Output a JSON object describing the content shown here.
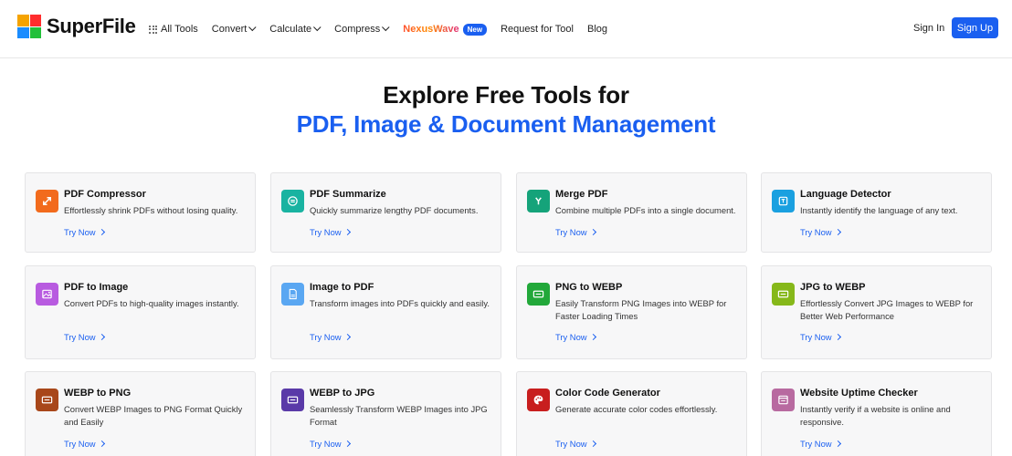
{
  "header": {
    "logo_text": "SuperFile",
    "nav": {
      "all_tools": "All Tools",
      "convert": "Convert",
      "calculate": "Calculate",
      "compress": "Compress",
      "nexuswave": "NexusWave",
      "new_badge": "New",
      "request": "Request for Tool",
      "blog": "Blog"
    },
    "sign_in": "Sign In",
    "sign_up": "Sign Up"
  },
  "hero": {
    "title": "Explore Free Tools for",
    "subtitle": "PDF, Image & Document Management"
  },
  "cards": [
    {
      "title": "PDF Compressor",
      "desc": "Effortlessly shrink PDFs without losing quality.",
      "cta": "Try Now",
      "icon": "compress-icon",
      "color": "#f26b1d"
    },
    {
      "title": "PDF Summarize",
      "desc": "Quickly summarize lengthy PDF documents.",
      "cta": "Try Now",
      "icon": "summarize-icon",
      "color": "#19b3a1"
    },
    {
      "title": "Merge PDF",
      "desc": "Combine multiple PDFs into a single document.",
      "cta": "Try Now",
      "icon": "merge-icon",
      "color": "#15a37a"
    },
    {
      "title": "Language Detector",
      "desc": "Instantly identify the language of any text.",
      "cta": "Try Now",
      "icon": "language-icon",
      "color": "#1aa0e0"
    },
    {
      "title": "PDF to Image",
      "desc": "Convert PDFs to high-quality images instantly.",
      "cta": "Try Now",
      "icon": "image-icon",
      "color": "#b85be0"
    },
    {
      "title": "Image to PDF",
      "desc": "Transform images into PDFs quickly and easily.",
      "cta": "Try Now",
      "icon": "pdf-file-icon",
      "color": "#5aa7f2"
    },
    {
      "title": "PNG to WEBP",
      "desc": "Easily Transform PNG Images into WEBP for Faster Loading Times",
      "cta": "Try Now",
      "icon": "convert-icon",
      "color": "#22a83a"
    },
    {
      "title": "JPG to WEBP",
      "desc": "Effortlessly Convert JPG Images to WEBP for Better Web Performance",
      "cta": "Try Now",
      "icon": "convert-icon",
      "color": "#86b81a"
    },
    {
      "title": "WEBP to PNG",
      "desc": "Convert WEBP Images to PNG Format Quickly and Easily",
      "cta": "Try Now",
      "icon": "convert-icon",
      "color": "#a8471a"
    },
    {
      "title": "WEBP to JPG",
      "desc": "Seamlessly Transform WEBP Images into JPG Format",
      "cta": "Try Now",
      "icon": "convert-icon",
      "color": "#5a3aa8"
    },
    {
      "title": "Color Code Generator",
      "desc": "Generate accurate color codes effortlessly.",
      "cta": "Try Now",
      "icon": "palette-icon",
      "color": "#c81e1e"
    },
    {
      "title": "Website Uptime Checker",
      "desc": "Instantly verify if a website is online and responsive.",
      "cta": "Try Now",
      "icon": "browser-icon",
      "color": "#b86aa0"
    }
  ]
}
